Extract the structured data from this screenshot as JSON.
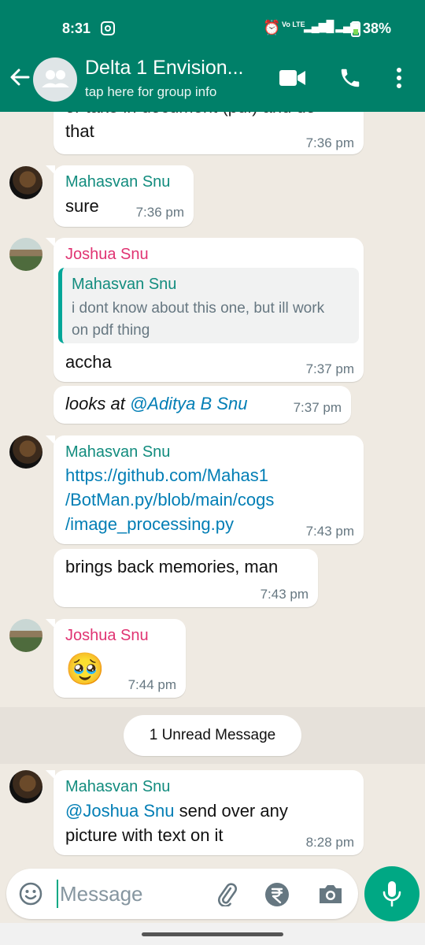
{
  "status_bar": {
    "time": "8:31",
    "network": "Vo LTE",
    "signal": "⁵ᴳ",
    "battery": "38%"
  },
  "header": {
    "title": "Delta 1 Envision...",
    "subtitle": "tap here for group info"
  },
  "messages": [
    {
      "id": "m0",
      "text": "that",
      "time": "7:36 pm",
      "partial_above": "or take in document (pdf) and do"
    },
    {
      "id": "m1",
      "sender": "Mahasvan Snu",
      "text": "sure",
      "time": "7:36 pm"
    },
    {
      "id": "m2",
      "sender": "Joshua Snu",
      "quote_sender": "Mahasvan Snu",
      "quote_text": "i dont know about this one, but ill work on pdf thing",
      "text": "accha",
      "time": "7:37 pm"
    },
    {
      "id": "m3",
      "text_prefix": "looks at ",
      "mention": "@Aditya B Snu",
      "time": "7:37 pm"
    },
    {
      "id": "m4",
      "sender": "Mahasvan Snu",
      "link_lines": [
        "https://github.com/Mahas1",
        "/BotMan.py/blob/main/cogs",
        "/image_processing.py"
      ],
      "time": "7:43 pm"
    },
    {
      "id": "m5",
      "text": "brings back memories, man",
      "time": "7:43 pm"
    },
    {
      "id": "m6",
      "sender": "Joshua Snu",
      "emoji": "🥹",
      "time": "7:44 pm"
    },
    {
      "id": "m7",
      "sender": "Mahasvan Snu",
      "mention": "@Joshua Snu",
      "text_suffix": " send over any",
      "text_line2": "picture with text on it",
      "time": "8:28 pm"
    }
  ],
  "unread_label": "1 Unread Message",
  "composer": {
    "placeholder": "Message"
  },
  "colors": {
    "header": "#008069",
    "accent": "#00a884",
    "sender_green": "#128c7e",
    "sender_pink": "#e03372",
    "link": "#027eb5"
  },
  "icons": [
    "back-arrow-icon",
    "group-avatar-icon",
    "video-call-icon",
    "phone-icon",
    "more-vert-icon",
    "emoji-icon",
    "attach-icon",
    "rupee-icon",
    "camera-icon",
    "mic-icon"
  ]
}
